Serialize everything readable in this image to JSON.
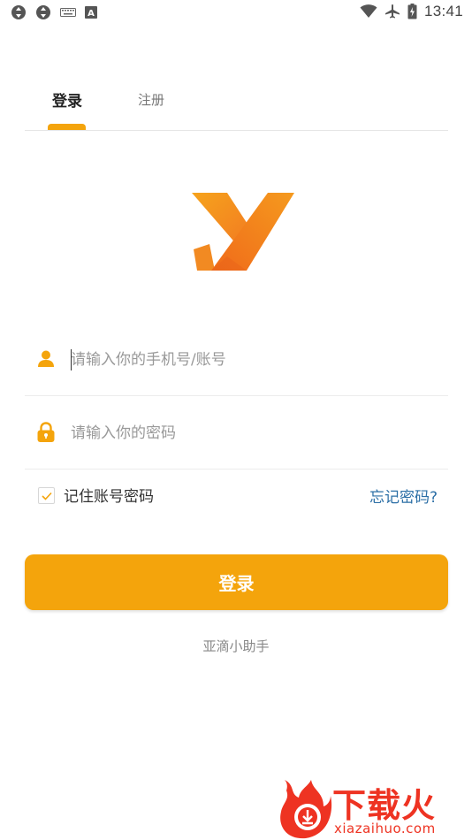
{
  "status_bar": {
    "time": "13:41",
    "left_icons": [
      "sync-icon",
      "sync-icon",
      "keyboard-icon",
      "a-letter-icon"
    ],
    "right_icons": [
      "wifi-icon",
      "airplane-icon",
      "battery-icon"
    ]
  },
  "tabs": [
    {
      "label": "登录",
      "active": true
    },
    {
      "label": "注册",
      "active": false
    }
  ],
  "form": {
    "account_placeholder": "请输入你的手机号/账号",
    "account_value": "",
    "password_placeholder": "请输入你的密码",
    "password_value": "",
    "account_icon": "user-icon",
    "password_icon": "lock-icon"
  },
  "remember": {
    "label": "记住账号密码",
    "checked": true
  },
  "forgot_label": "忘记密码?",
  "login_button_label": "登录",
  "app_name": "亚滴小助手",
  "watermark": {
    "title": "下载火",
    "subtitle": "xiazaihuo.com"
  },
  "colors": {
    "accent": "#f4a40c",
    "link": "#2c6fa6",
    "logo_orange": "#f47a20",
    "watermark_red": "#ee3322"
  }
}
